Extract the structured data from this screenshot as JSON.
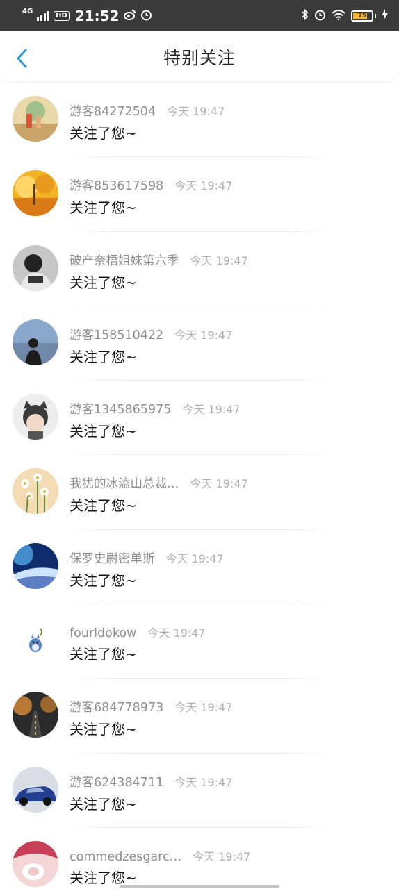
{
  "status_bar": {
    "network": "4G",
    "hd_label": "HD",
    "time": "21:52",
    "battery_level": "75",
    "battery_fraction": 0.75,
    "icons": [
      "signal-icon",
      "weibo-icon",
      "alarm-icon",
      "bluetooth-icon",
      "wifi-icon",
      "battery-icon",
      "charging-icon"
    ]
  },
  "header": {
    "title": "特别关注",
    "back_icon": "chevron-left-icon",
    "accent_color": "#2d9cdb"
  },
  "items": [
    {
      "name": "游客84272504",
      "time": "今天 19:47",
      "message": "关注了您~"
    },
    {
      "name": "游客853617598",
      "time": "今天 19:47",
      "message": "关注了您~"
    },
    {
      "name": "破产奈梧姐妹第六季",
      "time": "今天 19:47",
      "message": "关注了您~"
    },
    {
      "name": "游客158510422",
      "time": "今天 19:47",
      "message": "关注了您~"
    },
    {
      "name": "游客1345865975",
      "time": "今天 19:47",
      "message": "关注了您~"
    },
    {
      "name": "我犹的冰溘山总裁…",
      "time": "今天 19:47",
      "message": "关注了您~"
    },
    {
      "name": "保罗史尉密单斯",
      "time": "今天 19:47",
      "message": "关注了您~"
    },
    {
      "name": "fourldokow",
      "time": "今天 19:47",
      "message": "关注了您~"
    },
    {
      "name": "游客684778973",
      "time": "今天 19:47",
      "message": "关注了您~"
    },
    {
      "name": "游客624384711",
      "time": "今天 19:47",
      "message": "关注了您~"
    },
    {
      "name": "commedzesgarc…",
      "time": "今天 19:47",
      "message": "关注了您~"
    }
  ]
}
